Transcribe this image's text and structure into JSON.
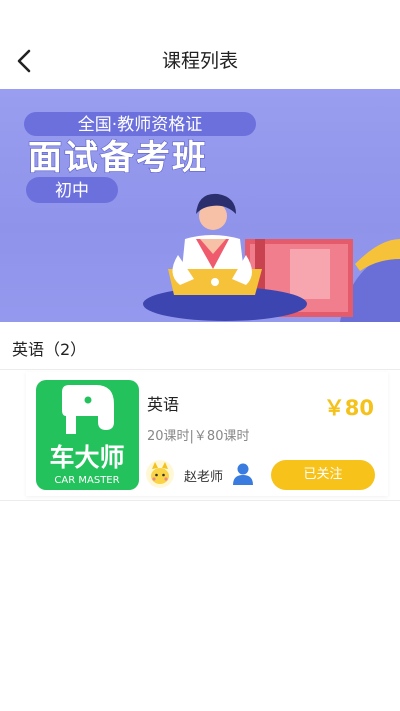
{
  "header": {
    "title": "课程列表",
    "back_icon": "chevron-left-icon"
  },
  "banner": {
    "tag_top": "全国·教师资格证",
    "headline": "面试备考班",
    "tag_level": "初中",
    "background_color": "#9a9ef0"
  },
  "section": {
    "title": "英语（2）"
  },
  "course": {
    "name": "英语",
    "meta": "20课时|￥80课时",
    "price": "￥80",
    "logo_brand": "车大师",
    "logo_brand_en": "CAR MASTER",
    "logo_color": "#23c25c",
    "teacher_name": "赵老师",
    "person_icon": "person-icon",
    "follow_label": "已关注",
    "accent_color": "#f7c21a"
  }
}
